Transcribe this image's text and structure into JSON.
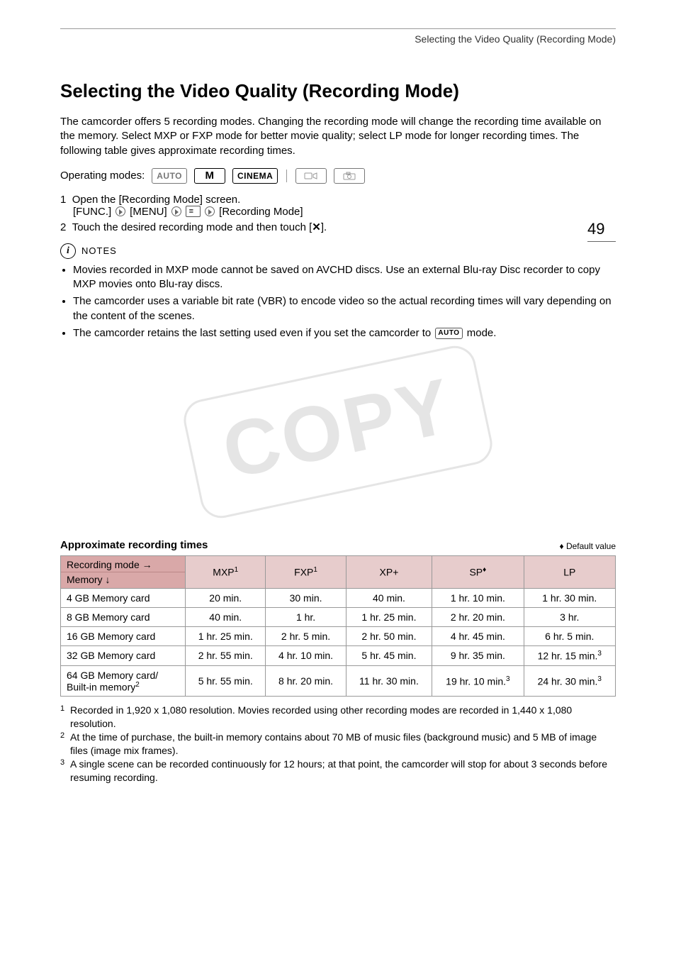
{
  "running_head": "Selecting the Video Quality (Recording Mode)",
  "page_number": "49",
  "title": "Selecting the Video Quality (Recording Mode)",
  "intro": "The camcorder offers 5 recording modes. Changing the recording mode will change the recording time available on the memory. Select MXP or FXP mode for better movie quality; select LP mode for longer recording times. The following table gives approximate recording times.",
  "operating_modes_label": "Operating modes:",
  "mode_chips": {
    "auto": "AUTO",
    "m": "M",
    "cinema": "CINEMA"
  },
  "steps": {
    "s1_prefix": "1",
    "s1_text": "Open the [Recording Mode] screen.",
    "s1_path": {
      "func": "[FUNC.]",
      "menu": "[MENU]",
      "rec": "[Recording Mode]"
    },
    "s2_prefix": "2",
    "s2_text_a": "Touch the desired recording mode and then touch [",
    "s2_text_b": "]."
  },
  "notes_label": "NOTES",
  "notes": [
    "Movies recorded in MXP mode cannot be saved on AVCHD discs. Use an external Blu-ray Disc recorder to copy MXP movies onto Blu-ray discs.",
    "The camcorder uses a variable bit rate (VBR) to encode video so the actual recording times will vary depending on the content of the scenes."
  ],
  "note3_a": "The camcorder retains the last setting used even if you set the camcorder to ",
  "note3_badge": "AUTO",
  "note3_b": " mode.",
  "watermark_text": "COPY",
  "table_title": "Approximate recording times",
  "default_label": "Default value",
  "table": {
    "corner_top": "Recording mode →",
    "corner_bottom": "Memory ↓",
    "cols": [
      {
        "label": "MXP",
        "sup": "1"
      },
      {
        "label": "FXP",
        "sup": "1"
      },
      {
        "label": "XP+",
        "sup": ""
      },
      {
        "label": "SP",
        "sup": "♦"
      },
      {
        "label": "LP",
        "sup": ""
      }
    ],
    "rows": [
      {
        "label": "4 GB Memory card",
        "sup": "",
        "cells": [
          {
            "v": "20 min."
          },
          {
            "v": "30 min."
          },
          {
            "v": "40 min."
          },
          {
            "v": "1 hr. 10 min."
          },
          {
            "v": "1 hr. 30 min."
          }
        ]
      },
      {
        "label": "8 GB Memory card",
        "sup": "",
        "cells": [
          {
            "v": "40 min."
          },
          {
            "v": "1 hr."
          },
          {
            "v": "1 hr. 25 min."
          },
          {
            "v": "2 hr. 20 min."
          },
          {
            "v": "3 hr."
          }
        ]
      },
      {
        "label": "16 GB Memory card",
        "sup": "",
        "cells": [
          {
            "v": "1 hr. 25 min."
          },
          {
            "v": "2 hr. 5 min."
          },
          {
            "v": "2 hr. 50 min."
          },
          {
            "v": "4 hr. 45 min."
          },
          {
            "v": "6 hr. 5 min."
          }
        ]
      },
      {
        "label": "32 GB Memory card",
        "sup": "",
        "cells": [
          {
            "v": "2 hr. 55 min."
          },
          {
            "v": "4 hr. 10 min."
          },
          {
            "v": "5 hr. 45 min."
          },
          {
            "v": "9 hr. 35 min."
          },
          {
            "v": "12 hr. 15 min.",
            "sup": "3"
          }
        ]
      },
      {
        "label": "64 GB Memory card/\nBuilt-in memory",
        "sup": "2",
        "cells": [
          {
            "v": "5 hr. 55 min."
          },
          {
            "v": "8 hr. 20 min."
          },
          {
            "v": "11 hr. 30 min."
          },
          {
            "v": "19 hr. 10 min.",
            "sup": "3"
          },
          {
            "v": "24 hr. 30 min.",
            "sup": "3"
          }
        ]
      }
    ]
  },
  "footnotes": [
    {
      "n": "1",
      "t": "Recorded in 1,920 x 1,080 resolution. Movies recorded using other recording modes are recorded in 1,440 x 1,080 resolution."
    },
    {
      "n": "2",
      "t": "At the time of purchase, the built-in memory contains about 70 MB of music files (background music) and 5 MB of image files (image mix frames)."
    },
    {
      "n": "3",
      "t": "A single scene can be recorded continuously for 12 hours; at that point, the camcorder will stop for about 3 seconds before resuming recording."
    }
  ]
}
